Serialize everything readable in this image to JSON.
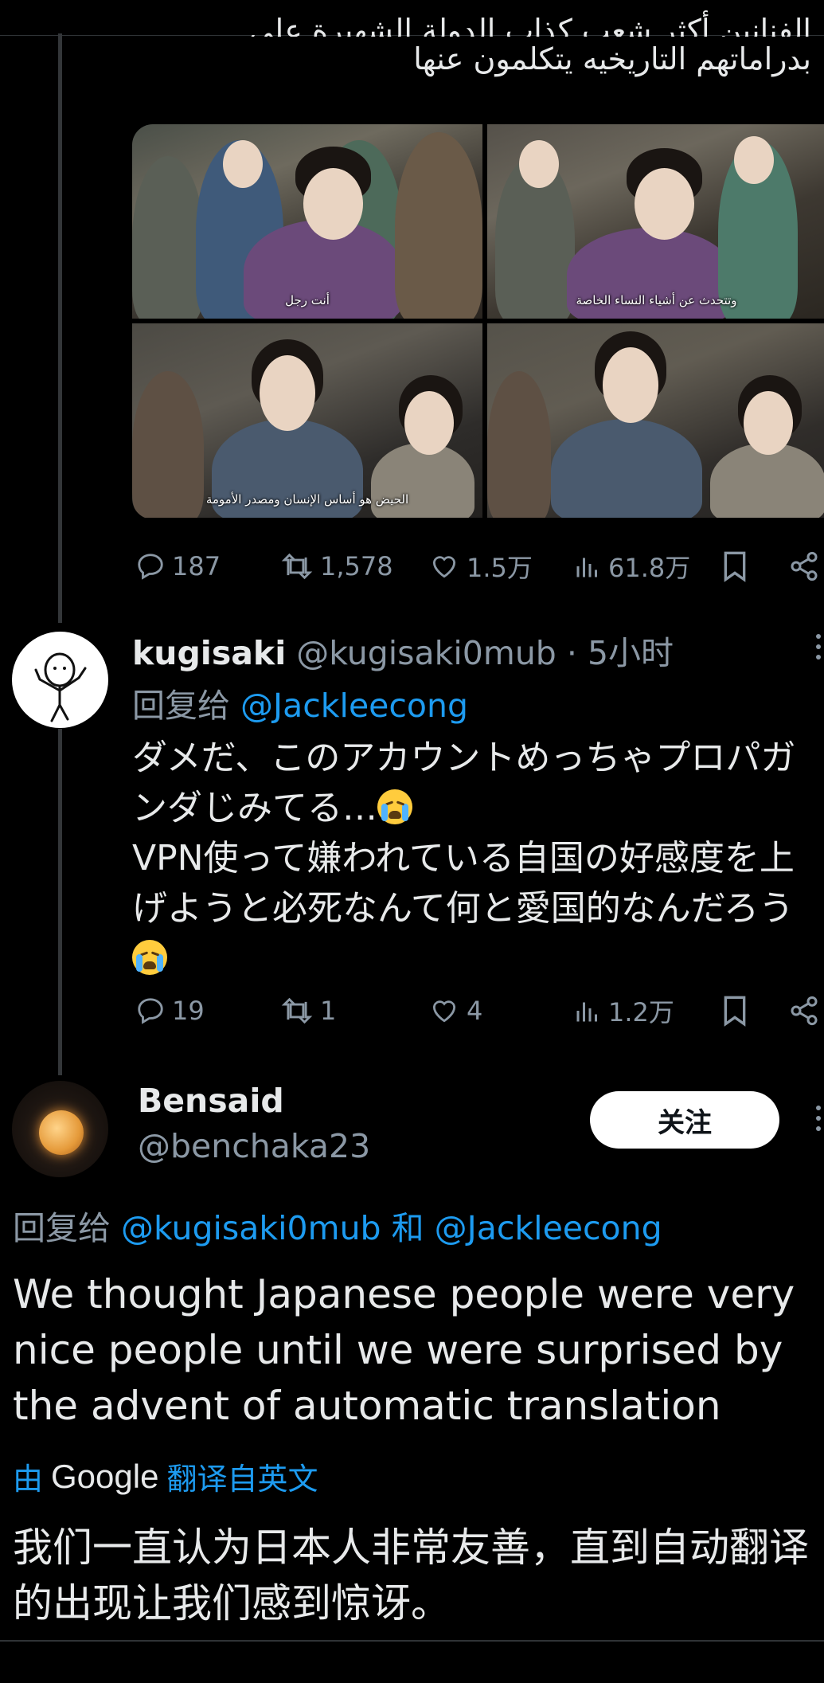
{
  "tweet1": {
    "text_line1": "الفنانين أكثر شعب كذاب الدولة الشهيرة على",
    "text_line2": "بدراماتهم التاريخيه يتكلمون عنها",
    "media": [
      {
        "subtitle": "أنت رجل"
      },
      {
        "subtitle": "وتتحدث عن أشياء النساء الخاصة"
      },
      {
        "subtitle": "الحيض هو أساس الإنسان ومصدر الأمومة"
      },
      {
        "subtitle": ""
      }
    ],
    "stats": {
      "replies": "187",
      "reposts": "1,578",
      "likes": "1.5万",
      "views": "61.8万"
    }
  },
  "tweet2": {
    "name": "kugisaki",
    "handle": "@kugisaki0mub",
    "time": "· 5小时",
    "reply_prefix": "回复给 ",
    "reply_to": "@Jackleecong",
    "text_line1": "ダメだ、このアカウントめっちゃプロパガンダじみてる…",
    "text_line2": "VPN使って嫌われている自国の好感度を上げようと必死なんて何と愛国的なんだろう",
    "stats": {
      "replies": "19",
      "reposts": "1",
      "likes": "4",
      "views": "1.2万"
    }
  },
  "tweet3": {
    "name": "Bensaid",
    "handle": "@benchaka23",
    "follow_label": "关注",
    "reply_prefix": "回复给 ",
    "reply_to_1": "@kugisaki0mub",
    "reply_join": " 和 ",
    "reply_to_2": "@Jackleecong",
    "text": "We thought Japanese people were very nice people until we were surprised by the advent of automatic translation",
    "translated_by_prefix": "由",
    "translated_by_brand": "Google",
    "translated_by_suffix": "翻译自英文",
    "translation": "我们一直认为日本人非常友善，直到自动翻译的出现让我们感到惊讶。"
  },
  "icons": [
    "reply-icon",
    "repost-icon",
    "like-icon",
    "views-icon",
    "bookmark-icon",
    "share-icon",
    "more-icon",
    "crying-emoji"
  ],
  "colors": {
    "background": "#000000",
    "text": "#e7e9ea",
    "muted": "#8b98a5",
    "accent": "#1d9bf0",
    "follow_button": "#ffffff"
  }
}
